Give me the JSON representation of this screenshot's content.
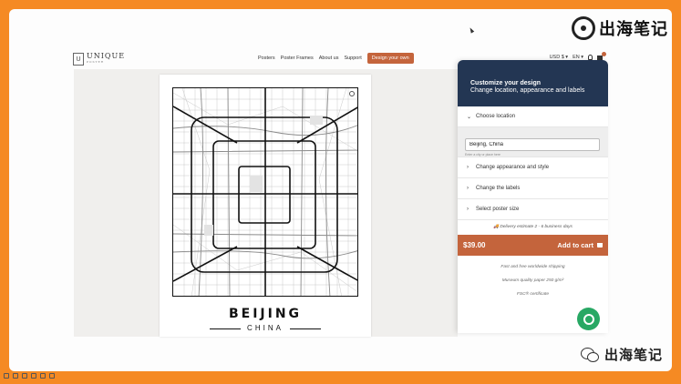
{
  "watermark": {
    "top_text": "出海笔记",
    "bottom_text": "出海笔记"
  },
  "header": {
    "logo_mark": "U",
    "logo_name": "UNIQUE",
    "logo_sub": "POSTER",
    "nav": [
      "Posters",
      "Poster Frames",
      "About us",
      "Support"
    ],
    "cta": "Design your own",
    "currency": "USD $ ▾",
    "language": "EN ▾"
  },
  "poster": {
    "city": "BEIJING",
    "country": "CHINA"
  },
  "panel": {
    "title": "Customize your design",
    "subtitle": "Change location, appearance and labels",
    "sections": {
      "location": "Choose location",
      "appearance": "Change appearance and style",
      "labels": "Change the labels",
      "size": "Select poster size"
    },
    "location_value": "Beijing, China",
    "location_hint": "Enter a city or place here",
    "delivery": "🚚 Delivery estimate 2 - 6 business days",
    "price": "$39.00",
    "add_to_cart": "Add to cart",
    "perks": [
      "Fast and free worldwide shipping",
      "Museum quality paper 250 g/m²",
      "FSC® certificate"
    ]
  },
  "icons": {
    "whatsapp": "whatsapp-icon",
    "cart": "cart-icon",
    "user": "user-icon",
    "bag": "bag-icon"
  },
  "colors": {
    "frame": "#f58a23",
    "panel_header": "#233653",
    "accent": "#c4643c",
    "whatsapp": "#28a864"
  }
}
